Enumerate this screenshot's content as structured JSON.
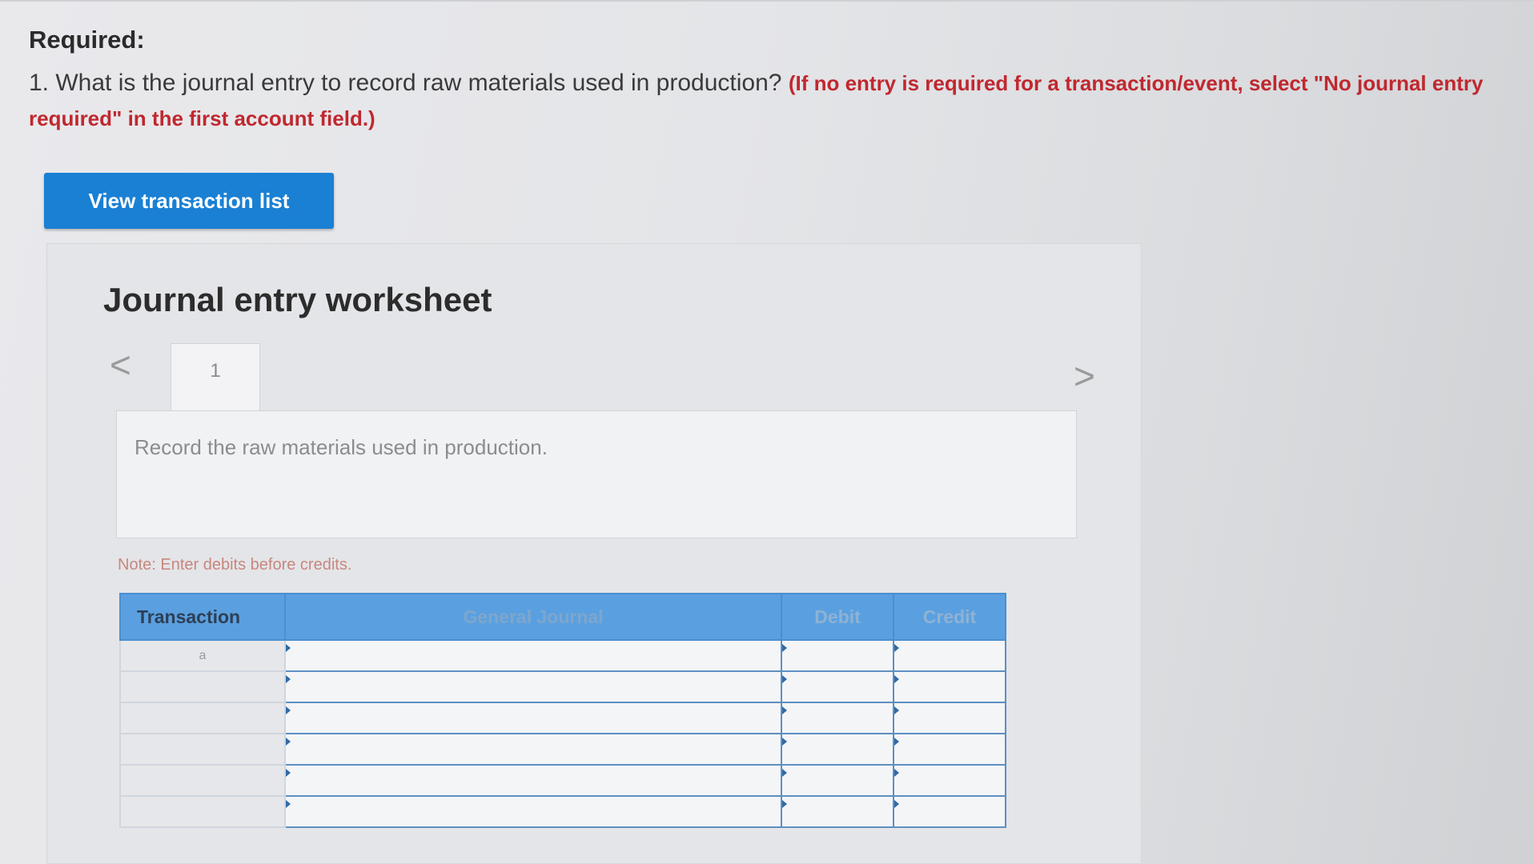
{
  "required": {
    "heading": "Required:",
    "question": "1. What is the journal entry to record raw materials used in production?",
    "instruction": "(If no entry is required for a transaction/event, select \"No journal entry required\" in the first account field.)"
  },
  "view_button_label": "View transaction list",
  "worksheet": {
    "title": "Journal entry worksheet",
    "tab_label": "1",
    "prev_arrow": "<",
    "next_arrow": ">",
    "description": "Record the raw materials used in production.",
    "note": "Note: Enter debits before credits."
  },
  "table": {
    "headers": {
      "transaction": "Transaction",
      "general_journal": "General Journal",
      "debit": "Debit",
      "credit": "Credit"
    },
    "rows": [
      {
        "transaction": "a"
      },
      {
        "transaction": ""
      },
      {
        "transaction": ""
      },
      {
        "transaction": ""
      },
      {
        "transaction": ""
      },
      {
        "transaction": ""
      }
    ]
  },
  "colors": {
    "button_blue": "#1a80d3",
    "header_blue": "#5aa0e0",
    "instruction_red": "#c0282f"
  }
}
